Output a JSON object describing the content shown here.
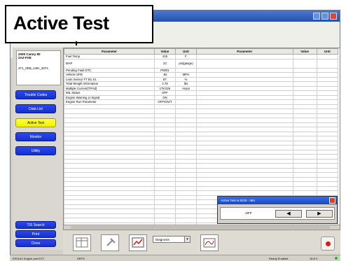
{
  "caption": "Active Test",
  "vehicle": {
    "model_line1": "2005 Camry 90",
    "model_line2": "2AZ-FXE",
    "vin": "4T1_0EB_U9H_2874"
  },
  "nav": [
    {
      "label": "Trouble Codes",
      "active": false
    },
    {
      "label": "Data List",
      "active": false
    },
    {
      "label": "Active Test",
      "active": true
    },
    {
      "label": "Monitor",
      "active": false
    },
    {
      "label": "Utility",
      "active": false
    }
  ],
  "nav_bottom": [
    {
      "label": "TIS Search"
    },
    {
      "label": "Print"
    },
    {
      "label": "Close"
    }
  ],
  "table": {
    "headers": [
      "Parameter",
      "Value",
      "Unit",
      "Parameter",
      "Value",
      "Unit"
    ],
    "rows": [
      {
        "parameter": "Fuel Temp",
        "value": "415",
        "unit": "F"
      },
      {
        "parameter": "MAP",
        "value": "22",
        "unit": "psi(gauge)",
        "tall": true
      },
      {
        "parameter": "Pending Fault DTC",
        "value": "P0001",
        "unit": ""
      },
      {
        "parameter": "Vehicle SPD",
        "value": "-82",
        "unit": "MPH"
      },
      {
        "parameter": "Lean Sensor FT B1 S1",
        "value": "97",
        "unit": "%"
      },
      {
        "parameter": "Total Weight Information",
        "value": "2.78",
        "unit": "lbs"
      },
      {
        "parameter": "Multiple Current(TP/sd)",
        "value": "178.026",
        "unit": "Amps"
      },
      {
        "parameter": "MIL Status",
        "value": "OFF",
        "unit": ""
      },
      {
        "parameter": "Engine Warning Lt Signal",
        "value": "ON",
        "unit": ""
      },
      {
        "parameter": "Engine Run Parameter",
        "value": "OFF/ON/T",
        "unit": ""
      }
    ],
    "empty_rows": 27
  },
  "dialog": {
    "title": "Active Test  N 8230 - IM3",
    "value": "OFF",
    "left_button": "◀",
    "right_button": "▶"
  },
  "toolbar": {
    "select_value": "Diagnosis"
  },
  "status": {
    "left": "ES01A1  Engine and ECT",
    "middle": "DEFG",
    "right1": "Ready Enabled",
    "right2": "16.8 V"
  }
}
